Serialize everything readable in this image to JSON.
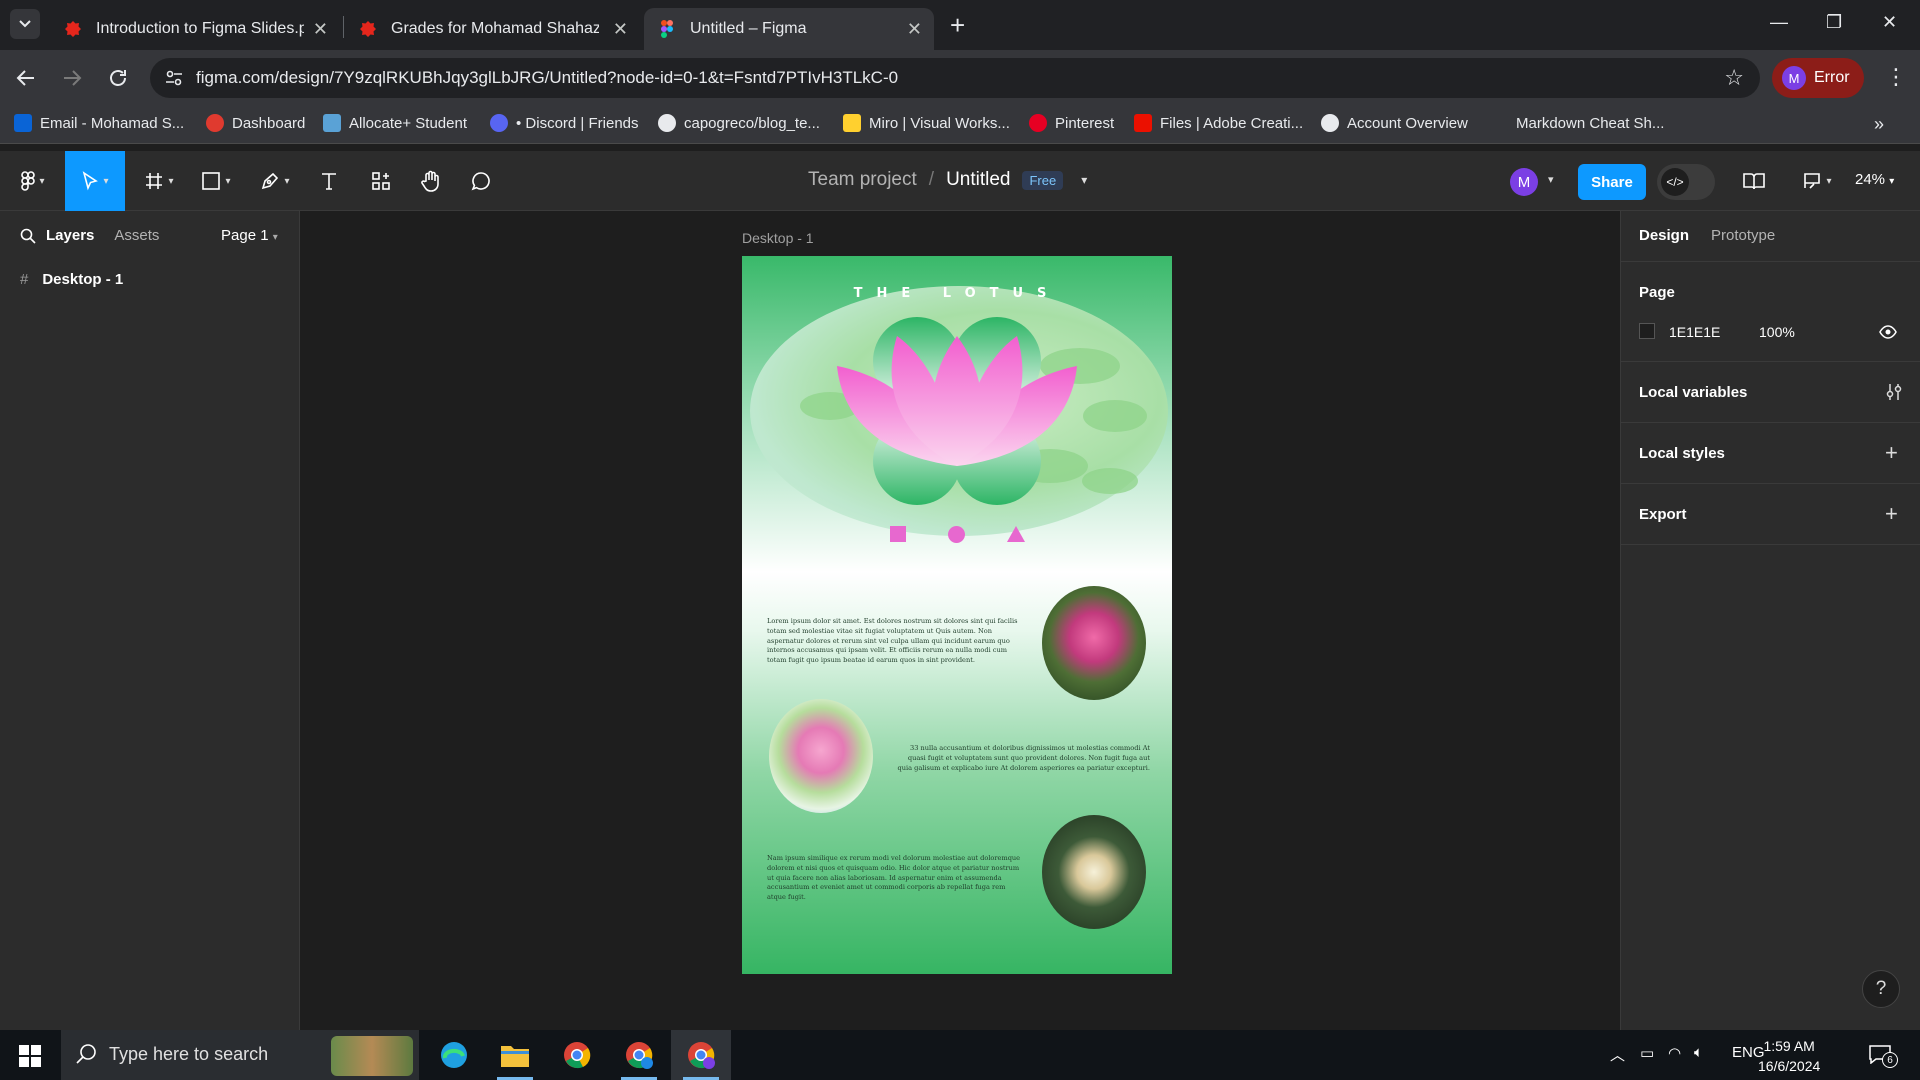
{
  "browser": {
    "tabs": [
      {
        "title": "Introduction to Figma Slides.pdf",
        "icon": "pdf-icon",
        "active": false
      },
      {
        "title": "Grades for Mohamad Shahazrin",
        "icon": "pdf-icon",
        "active": false
      },
      {
        "title": "Untitled – Figma",
        "icon": "figma-icon",
        "active": true
      }
    ],
    "url": "figma.com/design/7Y9zqlRKUBhJqy3glLbJRG/Untitled?node-id=0-1&t=Fsntd7PTIvH3TLkC-0",
    "profile_initial": "M",
    "profile_label": "Error",
    "bookmarks": [
      {
        "label": "Email - Mohamad S...",
        "color": "#0a64d6"
      },
      {
        "label": "Dashboard",
        "color": "#e03a2f"
      },
      {
        "label": "Allocate+ Student",
        "color": "#5aa2d6"
      },
      {
        "label": "• Discord | Friends",
        "color": "#5865f2"
      },
      {
        "label": "capogreco/blog_te...",
        "color": "#e8eaed"
      },
      {
        "label": "Miro | Visual Works...",
        "color": "#ffd02f"
      },
      {
        "label": "Pinterest",
        "color": "#e60023"
      },
      {
        "label": "Files | Adobe Creati...",
        "color": "#eb1000"
      },
      {
        "label": "Account Overview",
        "color": "#e8eaed"
      },
      {
        "label": "Markdown Cheat Sh...",
        "color": "#35363a"
      }
    ]
  },
  "figma": {
    "breadcrumb_team": "Team project",
    "breadcrumb_separator": "/",
    "file_name": "Untitled",
    "plan_badge": "Free",
    "user_initial": "M",
    "share_label": "Share",
    "zoom": "24%",
    "left_panel": {
      "tab_layers": "Layers",
      "tab_assets": "Assets",
      "page_selector": "Page 1",
      "layers": [
        "Desktop - 1"
      ]
    },
    "right_panel": {
      "tab_design": "Design",
      "tab_prototype": "Prototype",
      "page_heading": "Page",
      "page_color": "1E1E1E",
      "page_opacity": "100%",
      "local_variables": "Local variables",
      "local_styles": "Local styles",
      "export": "Export",
      "help": "?"
    },
    "canvas": {
      "frame_label": "Desktop - 1",
      "design": {
        "title": "THE LOTUS",
        "paragraph1": "Lorem ipsum dolor sit amet. Est dolores nostrum sit dolores sint qui facilis totam sed molestiae vitae sit fugiat voluptatem ut Quis autem. Non aspernatur dolores et rerum sint vel culpa ullam qui incidunt earum quo internos accusamus qui ipsam velit. Et officiis rerum ea nulla modi cum totam fugit quo ipsum beatae id earum quos in sint provident.",
        "paragraph2": "33 nulla accusantium et doloribus dignissimos ut molestias commodi At quasi fugit et voluptatem sunt quo provident dolores. Non fugit fuga aut quia galisum et explicabo iure At dolorem asperiores ea pariatur excepturi.",
        "paragraph3": "Nam ipsum similique ex rerum modi vel dolorum molestiae aut doloremque dolorem et nisi quos et quisquam odio. Hic dolor atque et pariatur nostrum ut quia facere non alias laboriosam. Id aspernatur enim et assumenda accusantium et eveniet amet ut commodi corporis ab repellat fuga rem atque fugit."
      }
    }
  },
  "taskbar": {
    "search_placeholder": "Type here to search",
    "language": "ENG",
    "time": "1:59 AM",
    "date": "16/6/2024",
    "notification_count": "6"
  }
}
